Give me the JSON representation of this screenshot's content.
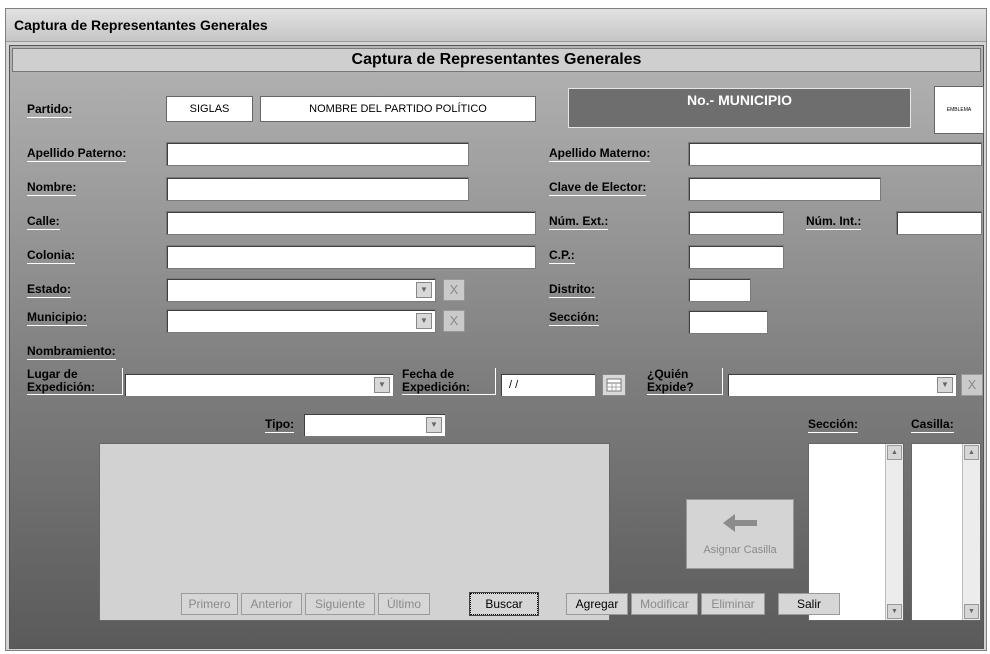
{
  "window": {
    "title": "Captura de Representantes Generales"
  },
  "header": {
    "title": "Captura de Representantes Generales"
  },
  "party": {
    "label": "Partido:",
    "siglas": "SIGLAS",
    "name": "NOMBRE DEL PARTIDO POLÍTICO",
    "municipio": "No.- MUNICIPIO",
    "emblema": "EMBLEMA"
  },
  "labels": {
    "apellido_paterno": "Apellido Paterno:",
    "apellido_materno": "Apellido Materno:",
    "nombre": "Nombre:",
    "clave_elector": "Clave de Elector:",
    "calle": "Calle:",
    "num_ext": "Núm. Ext.:",
    "num_int": "Núm. Int.:",
    "colonia": "Colonia:",
    "cp": "C.P.:",
    "estado": "Estado:",
    "distrito": "Distrito:",
    "municipio": "Municipio:",
    "seccion": "Sección:",
    "nombramiento": "Nombramiento:",
    "lugar_expedicion": "Lugar de Expedición:",
    "fecha_expedicion": "Fecha de Expedición:",
    "quien_expide": "¿Quién Expide?",
    "tipo": "Tipo:",
    "seccion_list": "Sección:",
    "casilla_list": "Casilla:"
  },
  "fields": {
    "fecha_value": "/ /"
  },
  "clear_glyph": "X",
  "assign": {
    "label": "Asignar Casilla"
  },
  "buttons": {
    "primero": "Primero",
    "anterior": "Anterior",
    "siguiente": "Siguiente",
    "ultimo": "Último",
    "buscar": "Buscar",
    "agregar": "Agregar",
    "modificar": "Modificar",
    "eliminar": "Eliminar",
    "salir": "Salir"
  }
}
